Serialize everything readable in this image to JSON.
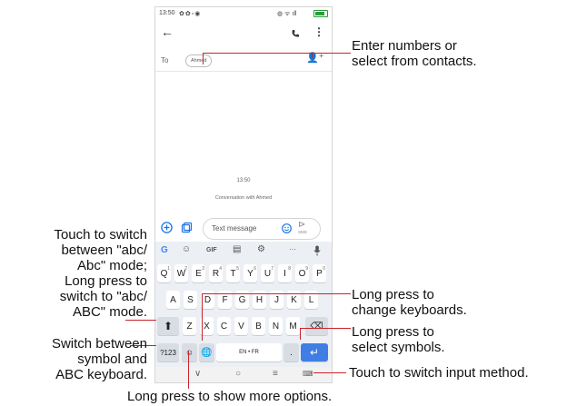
{
  "status": {
    "time": "13:50"
  },
  "to_field": {
    "label": "To",
    "recipient": "Ahmed"
  },
  "conversation": {
    "timestamp": "13:50",
    "header": "Conversation with Ahmed"
  },
  "compose": {
    "placeholder": "Text message",
    "send_sub": "SMS"
  },
  "suggestion_bar": {
    "gif": "GIF",
    "more": "···"
  },
  "keyboard": {
    "row1": [
      {
        "key": "Q",
        "hint": "1"
      },
      {
        "key": "W",
        "hint": "2"
      },
      {
        "key": "E",
        "hint": "3"
      },
      {
        "key": "R",
        "hint": "4"
      },
      {
        "key": "T",
        "hint": "5"
      },
      {
        "key": "Y",
        "hint": "6"
      },
      {
        "key": "U",
        "hint": "7"
      },
      {
        "key": "I",
        "hint": "8"
      },
      {
        "key": "O",
        "hint": "9"
      },
      {
        "key": "P",
        "hint": "0"
      }
    ],
    "row2": [
      "A",
      "S",
      "D",
      "F",
      "G",
      "H",
      "J",
      "K",
      "L"
    ],
    "row3": [
      "Z",
      "X",
      "C",
      "V",
      "B",
      "N",
      "M"
    ],
    "symbols_key": "?123",
    "space_label": "EN • FR",
    "period_key": "."
  },
  "annotations": {
    "enter_numbers": [
      "Enter numbers or",
      "select from contacts."
    ],
    "switch_case": [
      "Touch to switch",
      "between \"abc/",
      "Abc\" mode;",
      "Long press to",
      "switch to \"abc/",
      "ABC\" mode."
    ],
    "switch_keyboard": [
      "Switch between",
      "symbol and",
      "ABC keyboard."
    ],
    "change_keyboards": [
      "Long press to",
      "change keyboards."
    ],
    "select_symbols": [
      "Long press to",
      "select symbols."
    ],
    "input_method": "Touch to switch input method.",
    "more_options": "Long press to show more options."
  }
}
